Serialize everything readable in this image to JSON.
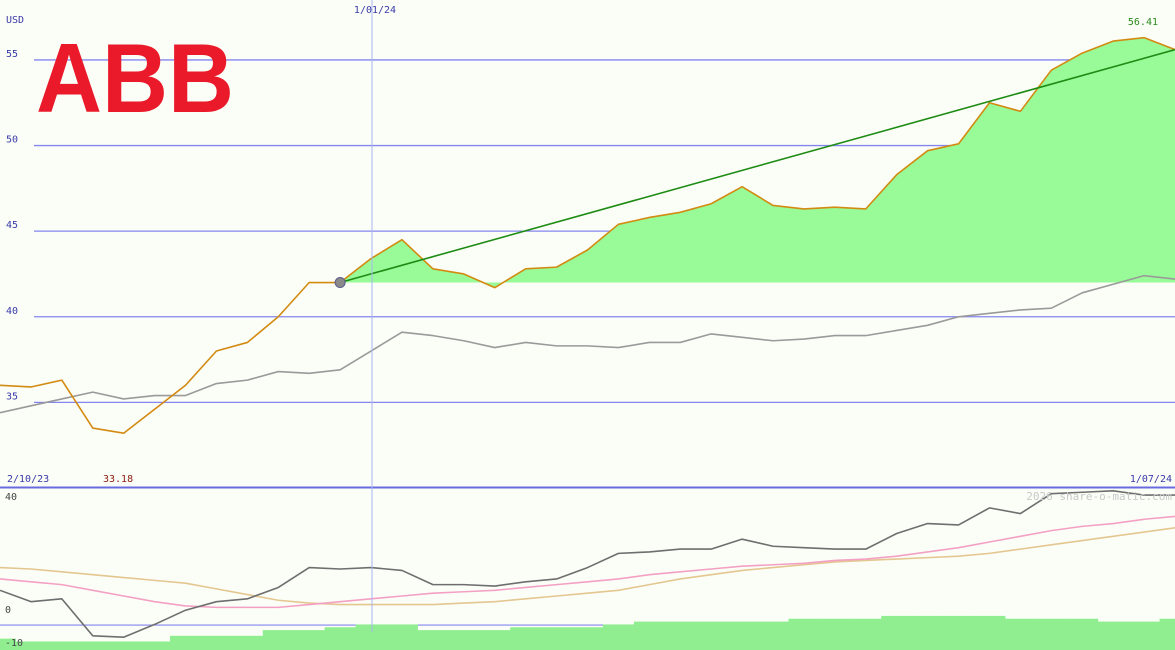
{
  "chart_data": [
    {
      "type": "line",
      "currency_label": "USD",
      "start_date": "2/10/23",
      "end_date": "1/07/24",
      "marker_date": "1/01/24",
      "high_label": "56.41",
      "low_label": "33.18",
      "y_ticks": [
        "35",
        "40",
        "45",
        "50",
        "55"
      ],
      "ylim": [
        30,
        58.5
      ],
      "x": [
        0,
        1,
        2,
        3,
        4,
        5,
        6,
        7,
        8,
        9,
        10,
        11,
        12,
        13,
        14,
        15,
        16,
        17,
        18,
        19,
        20,
        21,
        22,
        23,
        24,
        25,
        26,
        27,
        28,
        29,
        30,
        31,
        32,
        33,
        34,
        35,
        36,
        37,
        38
      ],
      "series": [
        {
          "values": [
            36.0,
            35.9,
            36.3,
            33.5,
            33.2,
            34.6,
            36.0,
            38.0,
            38.5,
            40.0,
            42.0,
            42.0,
            43.4,
            44.5,
            42.8,
            42.5,
            41.7,
            42.8,
            42.9,
            43.9,
            45.4,
            45.8,
            46.1,
            46.6,
            47.6,
            46.5,
            46.3,
            46.4,
            46.3,
            48.3,
            49.7,
            50.1,
            52.5,
            52.0,
            54.4,
            55.4,
            56.1,
            56.3,
            55.6
          ]
        },
        {
          "values": [
            34.4,
            34.8,
            35.2,
            35.6,
            35.2,
            35.4,
            35.4,
            36.1,
            36.3,
            36.8,
            36.7,
            36.9,
            38.0,
            39.1,
            38.9,
            38.6,
            38.2,
            38.5,
            38.3,
            38.3,
            38.2,
            38.5,
            38.5,
            39.0,
            38.8,
            38.6,
            38.7,
            38.9,
            38.9,
            39.2,
            39.5,
            40.0,
            40.2,
            40.4,
            40.5,
            41.4,
            41.9,
            42.4,
            42.2
          ]
        }
      ],
      "trend": {
        "from_index": 11,
        "from_value": 42.0,
        "to_index": 38,
        "to_value": 55.6
      },
      "fill_baseline": 42.0,
      "marker_index": 12,
      "colors": {
        "price": "#d38a12",
        "average": "#9a9a9a",
        "trend": "#1e8c14",
        "fill": "#98fb98",
        "grid": "#8585f0",
        "logo": "#ea1a2b"
      }
    },
    {
      "type": "line",
      "y_ticks": [
        "40",
        "0",
        "-10"
      ],
      "ylim": [
        -13,
        44
      ],
      "series": [
        {
          "values": [
            8,
            4,
            5,
            -8,
            -8.5,
            -4,
            1,
            4,
            5,
            9,
            16,
            15.5,
            16,
            15,
            10,
            10,
            9.5,
            11,
            12,
            16,
            21,
            21.5,
            22.5,
            22.5,
            26,
            23.5,
            23,
            22.5,
            22.5,
            28,
            31.5,
            31,
            37,
            35,
            42,
            42.5,
            43,
            41.5,
            41.5
          ]
        },
        {
          "values": [
            12,
            11,
            10,
            8,
            6,
            4,
            2.5,
            2,
            2,
            2,
            3,
            4,
            5,
            6,
            7,
            7.5,
            8,
            9,
            10,
            11,
            12,
            13.5,
            14.5,
            15.5,
            16.5,
            17,
            17.5,
            18.5,
            19,
            20,
            21.5,
            23,
            25,
            27,
            29,
            30.5,
            31.5,
            33,
            34
          ]
        },
        {
          "values": [
            16,
            15.5,
            14.5,
            13.5,
            12.5,
            11.5,
            10.5,
            8.5,
            6.5,
            4.5,
            3.5,
            3,
            3,
            3,
            3,
            3.5,
            4,
            5,
            6,
            7,
            8,
            10,
            12,
            13.5,
            15,
            16,
            17,
            18,
            18.5,
            19,
            19.5,
            20,
            21,
            22.5,
            24,
            25.5,
            27,
            28.5,
            30
          ]
        },
        {
          "values": [
            -9,
            -10,
            -10,
            -10,
            -10,
            -10,
            -8,
            -8,
            -8,
            -6,
            -6,
            -5,
            -4,
            -4,
            -6,
            -6,
            -6,
            -5,
            -5,
            -5,
            -4,
            -3,
            -3,
            -3,
            -3,
            -3,
            -2,
            -2,
            -2,
            -1,
            -1,
            -1,
            -1,
            -2,
            -2,
            -2,
            -3,
            -3,
            -2
          ]
        }
      ],
      "colors": {
        "momentum": "#6e6e6e",
        "fast": "#f4a0c4",
        "slow": "#e4c690",
        "histogram": "#90ee90"
      }
    }
  ],
  "logo": {
    "text": "ABB"
  },
  "watermark": "2026 share-o-matic.com"
}
